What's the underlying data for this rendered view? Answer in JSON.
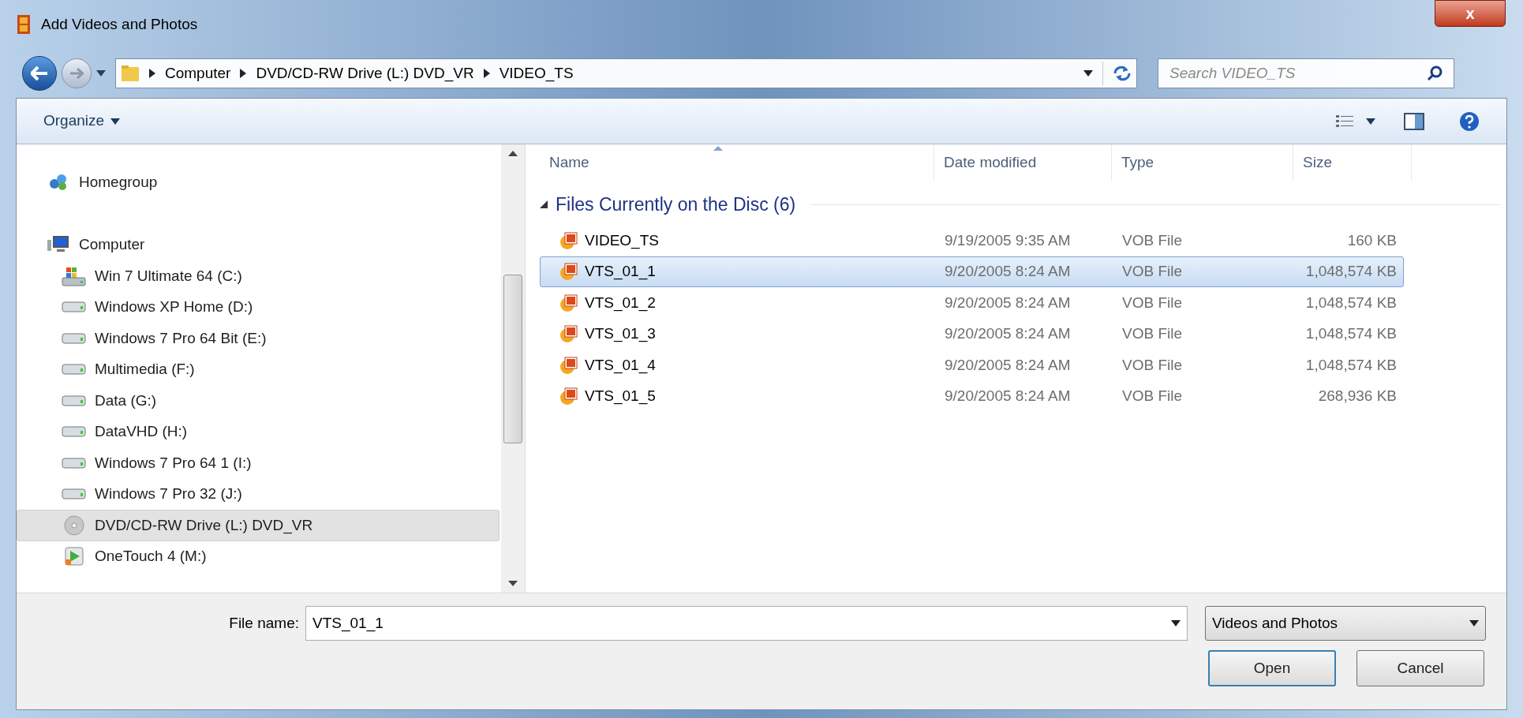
{
  "window": {
    "title": "Add Videos and Photos",
    "close": "x"
  },
  "breadcrumb": [
    "Computer",
    "DVD/CD-RW Drive (L:) DVD_VR",
    "VIDEO_TS"
  ],
  "search": {
    "placeholder": "Search VIDEO_TS"
  },
  "toolbar": {
    "organize": "Organize"
  },
  "sidebar": {
    "items": [
      {
        "label": "Homegroup",
        "kind": "homegroup",
        "selected": false
      },
      {
        "label": "Computer",
        "kind": "computer",
        "selected": false,
        "children": [
          {
            "label": "Win 7 Ultimate 64 (C:)",
            "kind": "system",
            "selected": false
          },
          {
            "label": "Windows XP Home (D:)",
            "kind": "drive",
            "selected": false
          },
          {
            "label": "Windows 7 Pro 64 Bit (E:)",
            "kind": "drive",
            "selected": false
          },
          {
            "label": "Multimedia (F:)",
            "kind": "drive",
            "selected": false
          },
          {
            "label": "Data (G:)",
            "kind": "drive",
            "selected": false
          },
          {
            "label": "DataVHD (H:)",
            "kind": "drive",
            "selected": false
          },
          {
            "label": "Windows 7 Pro 64 1 (I:)",
            "kind": "drive",
            "selected": false
          },
          {
            "label": "Windows 7 Pro 32 (J:)",
            "kind": "drive",
            "selected": false
          },
          {
            "label": "DVD/CD-RW Drive (L:) DVD_VR",
            "kind": "optical",
            "selected": true
          },
          {
            "label": "OneTouch 4 (M:)",
            "kind": "external",
            "selected": false
          }
        ]
      }
    ]
  },
  "table": {
    "columns": [
      {
        "label": "Name",
        "sorted": true
      },
      {
        "label": "Date modified",
        "sorted": false
      },
      {
        "label": "Type",
        "sorted": false
      },
      {
        "label": "Size",
        "sorted": false
      }
    ],
    "group": {
      "label": "Files Currently on the Disc (6)",
      "expanded": true
    },
    "rows": [
      {
        "name": "VIDEO_TS",
        "date": "9/19/2005 9:35 AM",
        "type": "VOB File",
        "size": "160 KB",
        "selected": false
      },
      {
        "name": "VTS_01_1",
        "date": "9/20/2005 8:24 AM",
        "type": "VOB File",
        "size": "1,048,574 KB",
        "selected": true
      },
      {
        "name": "VTS_01_2",
        "date": "9/20/2005 8:24 AM",
        "type": "VOB File",
        "size": "1,048,574 KB",
        "selected": false
      },
      {
        "name": "VTS_01_3",
        "date": "9/20/2005 8:24 AM",
        "type": "VOB File",
        "size": "1,048,574 KB",
        "selected": false
      },
      {
        "name": "VTS_01_4",
        "date": "9/20/2005 8:24 AM",
        "type": "VOB File",
        "size": "1,048,574 KB",
        "selected": false
      },
      {
        "name": "VTS_01_5",
        "date": "9/20/2005 8:24 AM",
        "type": "VOB File",
        "size": "268,936 KB",
        "selected": false
      }
    ]
  },
  "footer": {
    "file_name_label": "File name:",
    "file_name": "VTS_01_1",
    "filter": "Videos and Photos",
    "buttons": [
      {
        "label": "Open",
        "kind": "default"
      },
      {
        "label": "Cancel",
        "kind": "normal"
      }
    ]
  }
}
